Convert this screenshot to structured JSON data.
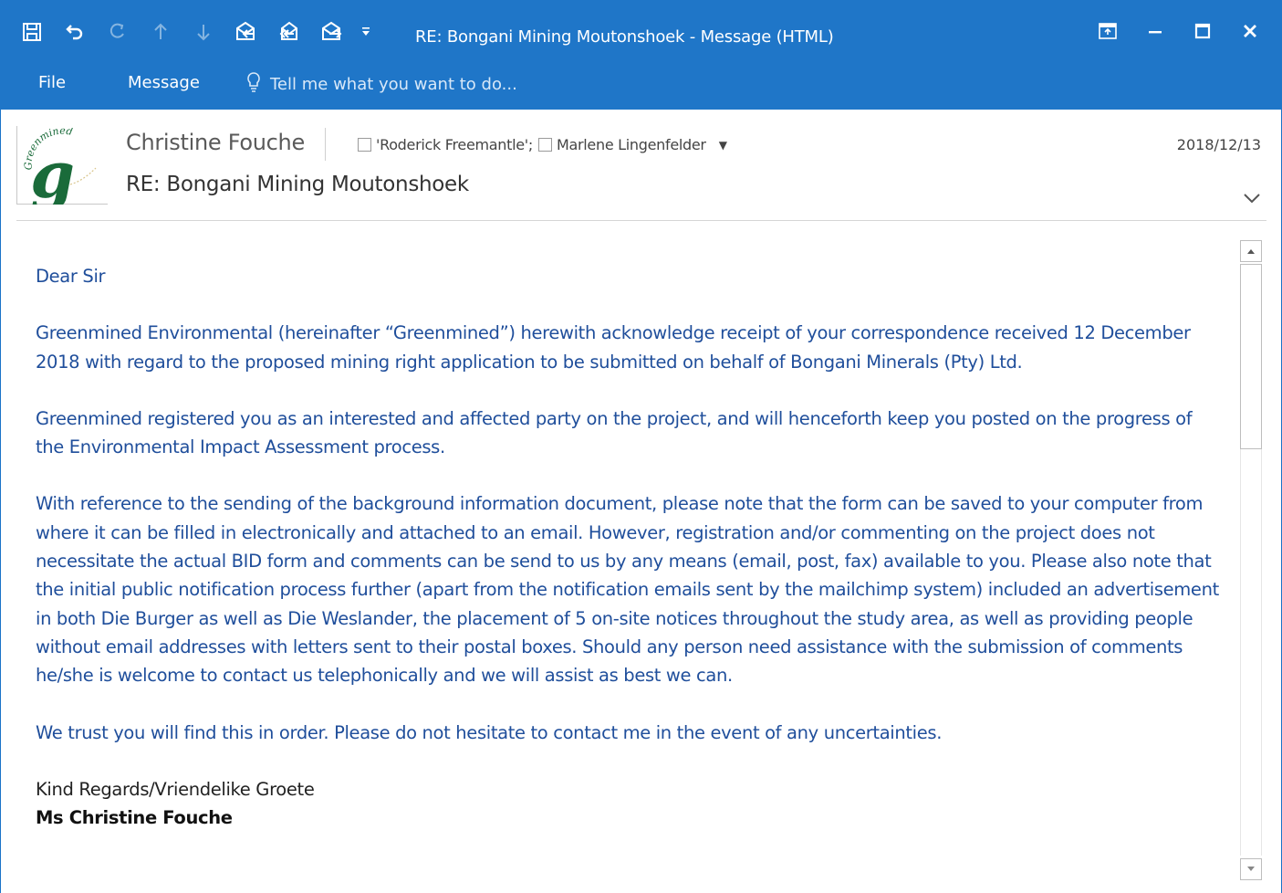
{
  "window": {
    "title": "RE: Bongani Mining Moutonshoek - Message (HTML)"
  },
  "qat": {
    "icons": [
      "save-icon",
      "undo-icon",
      "redo-icon",
      "previous-item-icon",
      "next-item-icon",
      "reply-icon",
      "reply-all-icon",
      "forward-icon",
      "customize-qat-icon"
    ]
  },
  "ribbon": {
    "tabs": [
      "File",
      "Message"
    ],
    "tell_me_placeholder": "Tell me what you want to do..."
  },
  "header": {
    "logo_text": "Greenmined",
    "logo_letter": "g",
    "sender": "Christine Fouche",
    "recipients": [
      "'Roderick Freemantle';",
      "Marlene Lingenfelder"
    ],
    "date": "2018/12/13",
    "subject": "RE: Bongani Mining Moutonshoek"
  },
  "body": {
    "greeting": "Dear Sir",
    "paragraphs": [
      "Greenmined Environmental (hereinafter “Greenmined”) herewith acknowledge receipt of your correspondence received 12 December 2018 with regard to the proposed mining right application to be submitted on behalf of Bongani Minerals (Pty) Ltd.",
      "Greenmined registered you as an interested and affected party on the project, and will henceforth keep you posted on the progress of the Environmental Impact Assessment process.",
      "With reference to the sending of the background information document, please note that the form can be saved to your computer from where it can be filled in electronically and attached to an email.  However, registration and/or commenting on the project does not necessitate the actual BID form and comments can be send to us by any means (email, post, fax) available to you.  Please also note that the initial public notification process further (apart from the notification emails sent by the mailchimp system) included an advertisement in both Die Burger as well as Die Weslander, the placement of 5 on-site notices throughout the study area, as well as providing people without email addresses with letters sent to their postal boxes.  Should any person need assistance with the submission of comments he/she is welcome to contact us telephonically and we will assist as best we can.",
      "We trust you will find this in order.  Please do not hesitate to contact me in the event of any uncertainties."
    ],
    "closing": "Kind Regards/Vriendelike Groete",
    "signature": "Ms Christine Fouche"
  },
  "scrollbar": {
    "position_fraction": 0.0,
    "visible_fraction": 0.3
  },
  "colors": {
    "titlebar": "#1f76c8",
    "body_text": "#1f4e9b",
    "logo_green": "#1a6b3a"
  }
}
